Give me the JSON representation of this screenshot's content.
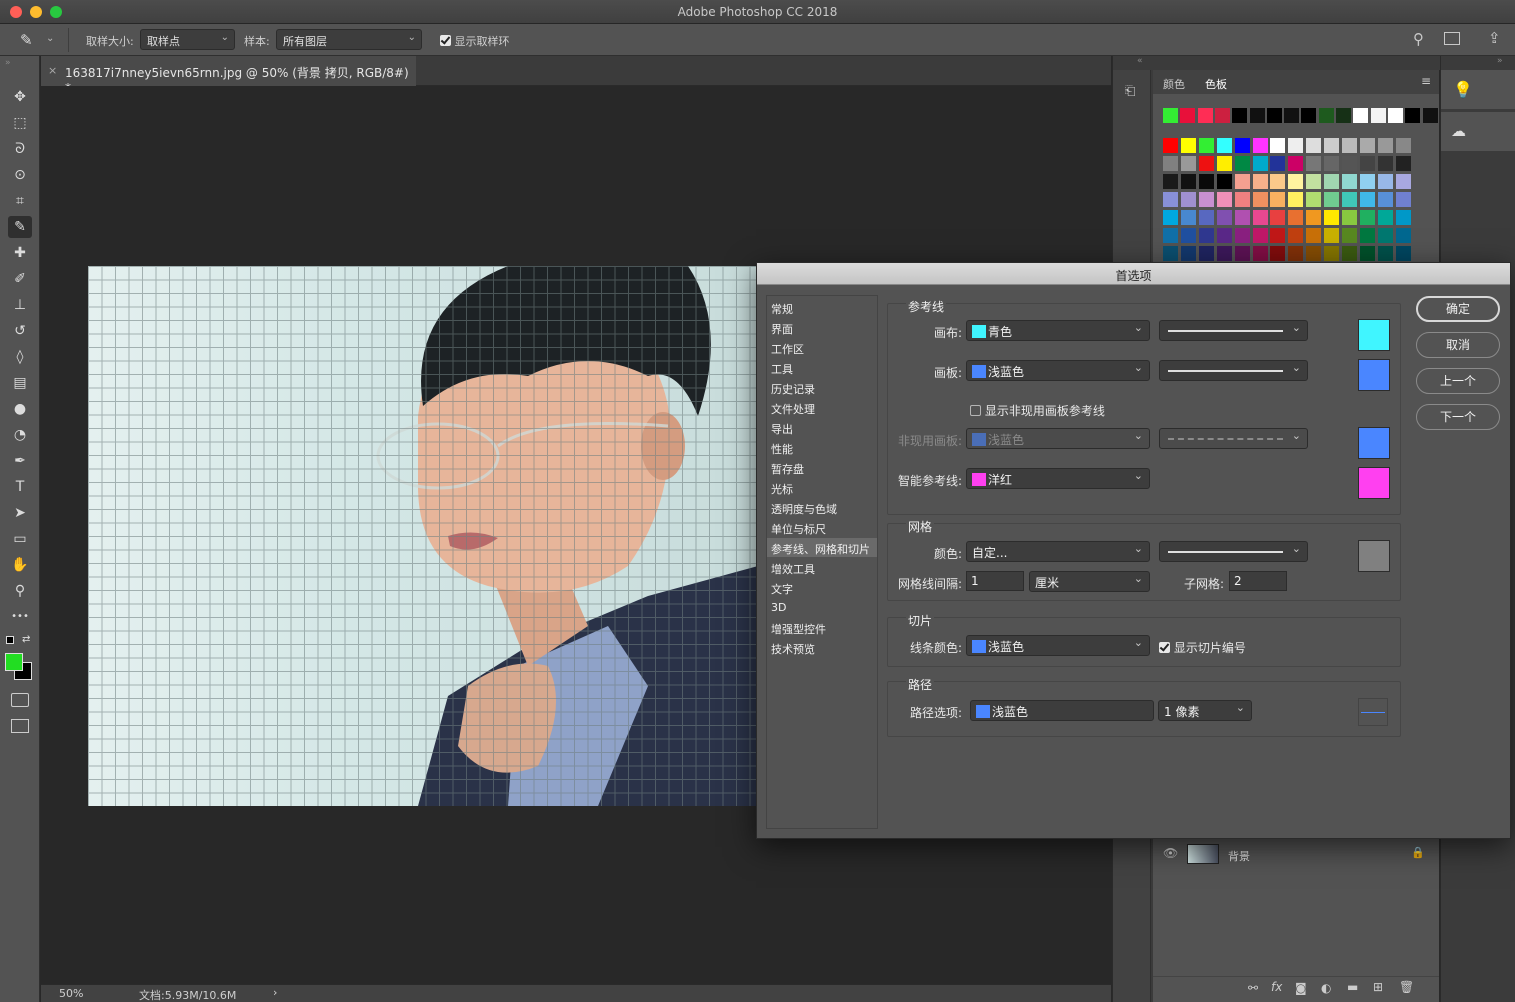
{
  "app": {
    "title": "Adobe Photoshop CC 2018",
    "traffic_colors": [
      "#ff5f57",
      "#febc2e",
      "#28c840"
    ]
  },
  "options_bar": {
    "sample_size_label": "取样大小:",
    "sample_size_value": "取样点",
    "sample_label": "样本:",
    "sample_value": "所有图层",
    "show_ring_label": "显示取样环"
  },
  "document": {
    "tab_title": "163817i7nney5ievn65rnn.jpg @ 50% (背景 拷贝, RGB/8#) *",
    "close_glyph": "×"
  },
  "status": {
    "zoom": "50%",
    "doc_info": "文档:5.93M/10.6M",
    "arrow": "›"
  },
  "tools": [
    {
      "name": "move-tool-icon",
      "glyph": "✥"
    },
    {
      "name": "marquee-tool-icon",
      "glyph": "⬚"
    },
    {
      "name": "lasso-tool-icon",
      "glyph": "ᘐ"
    },
    {
      "name": "quick-select-tool-icon",
      "glyph": "⊙"
    },
    {
      "name": "crop-tool-icon",
      "glyph": "⌗"
    },
    {
      "name": "eyedropper-tool-icon",
      "glyph": "✎"
    },
    {
      "name": "healing-brush-tool-icon",
      "glyph": "✚"
    },
    {
      "name": "brush-tool-icon",
      "glyph": "✐"
    },
    {
      "name": "stamp-tool-icon",
      "glyph": "⊥"
    },
    {
      "name": "history-brush-tool-icon",
      "glyph": "↺"
    },
    {
      "name": "eraser-tool-icon",
      "glyph": "◊"
    },
    {
      "name": "gradient-tool-icon",
      "glyph": "▤"
    },
    {
      "name": "blur-tool-icon",
      "glyph": "●"
    },
    {
      "name": "dodge-tool-icon",
      "glyph": "◔"
    },
    {
      "name": "pen-tool-icon",
      "glyph": "✒"
    },
    {
      "name": "type-tool-icon",
      "glyph": "T"
    },
    {
      "name": "path-select-tool-icon",
      "glyph": "➤"
    },
    {
      "name": "rectangle-tool-icon",
      "glyph": "▭"
    },
    {
      "name": "hand-tool-icon",
      "glyph": "✋"
    },
    {
      "name": "zoom-tool-icon",
      "glyph": "⚲"
    },
    {
      "name": "more-tools-icon",
      "glyph": "•••"
    }
  ],
  "colors": {
    "foreground": "#22dd22",
    "background": "#000000"
  },
  "swatches_panel": {
    "tab_color": "颜色",
    "tab_swatches": "色板",
    "recent": [
      "#33ee33",
      "#e8103a",
      "#ff2d55",
      "#cc2040",
      "#000000",
      "#111111",
      "#000000",
      "#111111",
      "#000000",
      "#1e5a1e",
      "#163016",
      "#ffffff",
      "#f3f3f3",
      "#ffffff",
      "#000000",
      "#111111"
    ],
    "grid": [
      [
        "#ff0000",
        "#ffff00",
        "#33ee33",
        "#33ffff",
        "#0000ff",
        "#ff33ff",
        "#ffffff",
        "#eeeeee",
        "#dddddd",
        "#cccccc",
        "#bbbbbb",
        "#aaaaaa",
        "#999999",
        "#888888"
      ],
      [
        "#808080",
        "#999999",
        "#ee1111",
        "#ffee00",
        "#008844",
        "#00aacc",
        "#223399",
        "#cc0066",
        "#777777",
        "#666666",
        "#555555",
        "#444444",
        "#333333",
        "#222222"
      ],
      [
        "#1a1a1a",
        "#111111",
        "#0a0a0a",
        "#000000",
        "#f4a090",
        "#f7b08a",
        "#fbc98a",
        "#fff3a0",
        "#c2e0a0",
        "#a0d6b0",
        "#90d8d0",
        "#90d0f0",
        "#98b8e8",
        "#a8a8e0"
      ],
      [
        "#8890d8",
        "#a090d0",
        "#c890d0",
        "#f090b8",
        "#f08080",
        "#f09060",
        "#f8b060",
        "#fff060",
        "#b0dc70",
        "#70cc90",
        "#40c8b8",
        "#40b8e8",
        "#5890d8",
        "#7080d0"
      ],
      [
        "#00a8e0",
        "#4888d0",
        "#5868c0",
        "#8050b0",
        "#b050b0",
        "#e84890",
        "#e84040",
        "#e87030",
        "#f09820",
        "#ffe800",
        "#88c840",
        "#20b060",
        "#00a898",
        "#0098c8"
      ],
      [
        "#1070a8",
        "#2050a0",
        "#303890",
        "#5a2888",
        "#8a2080",
        "#c01868",
        "#c01818",
        "#c04010",
        "#c87008",
        "#c8b000",
        "#588820",
        "#007840",
        "#007870",
        "#006890"
      ],
      [
        "#0b4f70",
        "#13386d",
        "#1f2460",
        "#3c185a",
        "#5c1254",
        "#800e44",
        "#800c0c",
        "#803008",
        "#844c04",
        "#847400",
        "#3a5a10",
        "#00502a",
        "#00504a",
        "#004660"
      ]
    ]
  },
  "layers": {
    "layer_name": "背景"
  },
  "dialog": {
    "title": "首选项",
    "categories": [
      "常规",
      "界面",
      "工作区",
      "工具",
      "历史记录",
      "文件处理",
      "导出",
      "性能",
      "暂存盘",
      "光标",
      "透明度与色域",
      "单位与标尺",
      "参考线、网格和切片",
      "增效工具",
      "文字",
      "3D",
      "增强型控件",
      "技术预览"
    ],
    "selected_category": "参考线、网格和切片",
    "buttons": {
      "ok": "确定",
      "cancel": "取消",
      "prev": "上一个",
      "next": "下一个"
    },
    "guides": {
      "title": "参考线",
      "canvas_label": "画布:",
      "canvas_value": "青色",
      "canvas_color": "#40f5ff",
      "artboard_label": "画板:",
      "artboard_value": "浅蓝色",
      "artboard_color": "#4a86ff",
      "show_inactive_label": "显示非现用画板参考线",
      "inactive_label": "非现用画板:",
      "inactive_value": "浅蓝色",
      "inactive_color": "#4a86ff",
      "smart_label": "智能参考线:",
      "smart_value": "洋红",
      "smart_color": "#ff40f0"
    },
    "grid": {
      "title": "网格",
      "color_label": "颜色:",
      "color_value": "自定...",
      "color_swatch": "#808080",
      "gridline_label": "网格线间隔:",
      "gridline_value": "1",
      "unit_value": "厘米",
      "subdiv_label": "子网格:",
      "subdiv_value": "2"
    },
    "slices": {
      "title": "切片",
      "line_color_label": "线条颜色:",
      "line_color_value": "浅蓝色",
      "line_color": "#4a86ff",
      "show_numbers_label": "显示切片编号"
    },
    "paths": {
      "title": "路径",
      "options_label": "路径选项:",
      "options_value": "浅蓝色",
      "options_color": "#4a86ff",
      "width_value": "1 像素"
    }
  }
}
